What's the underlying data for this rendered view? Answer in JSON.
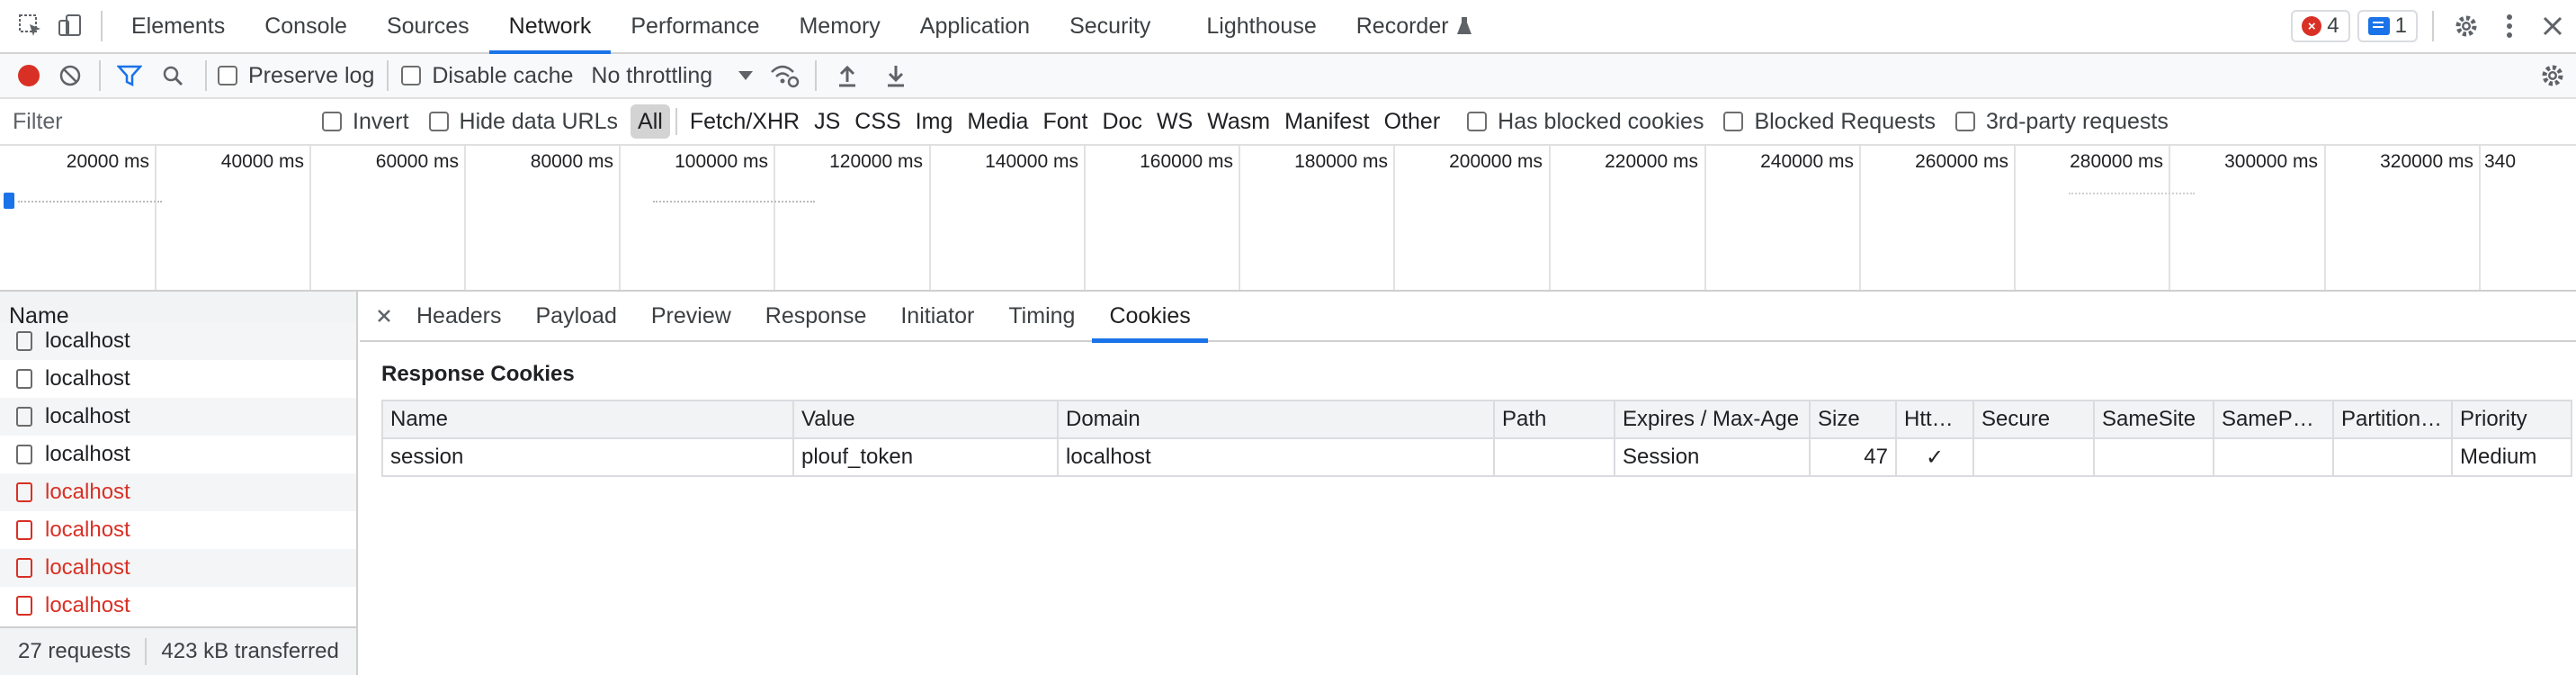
{
  "topbar": {
    "tabs": [
      "Elements",
      "Console",
      "Sources",
      "Network",
      "Performance",
      "Memory",
      "Application",
      "Security",
      "Lighthouse",
      "Recorder"
    ],
    "active_tab": "Network",
    "errors_count": "4",
    "messages_count": "1"
  },
  "toolbar": {
    "preserve_log": "Preserve log",
    "disable_cache": "Disable cache",
    "throttling": "No throttling"
  },
  "filterbar": {
    "placeholder": "Filter",
    "invert": "Invert",
    "hide_data_urls": "Hide data URLs",
    "types": [
      "All",
      "Fetch/XHR",
      "JS",
      "CSS",
      "Img",
      "Media",
      "Font",
      "Doc",
      "WS",
      "Wasm",
      "Manifest",
      "Other"
    ],
    "active_type": "All",
    "has_blocked_cookies": "Has blocked cookies",
    "blocked_requests": "Blocked Requests",
    "third_party": "3rd-party requests"
  },
  "overview": {
    "ticks": [
      "20000 ms",
      "40000 ms",
      "60000 ms",
      "80000 ms",
      "100000 ms",
      "120000 ms",
      "140000 ms",
      "160000 ms",
      "180000 ms",
      "200000 ms",
      "220000 ms",
      "240000 ms",
      "260000 ms",
      "280000 ms",
      "300000 ms",
      "320000 ms",
      "340"
    ]
  },
  "requests": {
    "header": "Name",
    "items": [
      {
        "name": "localhost",
        "error": false
      },
      {
        "name": "localhost",
        "error": false
      },
      {
        "name": "localhost",
        "error": false
      },
      {
        "name": "localhost",
        "error": false
      },
      {
        "name": "localhost",
        "error": true
      },
      {
        "name": "localhost",
        "error": true
      },
      {
        "name": "localhost",
        "error": true
      },
      {
        "name": "localhost",
        "error": true
      }
    ],
    "status_requests": "27 requests",
    "status_transferred": "423 kB transferred"
  },
  "details": {
    "tabs": [
      "Headers",
      "Payload",
      "Preview",
      "Response",
      "Initiator",
      "Timing",
      "Cookies"
    ],
    "active_tab": "Cookies",
    "section_title": "Response Cookies",
    "columns": [
      "Name",
      "Value",
      "Domain",
      "Path",
      "Expires / Max-Age",
      "Size",
      "HttpOnly",
      "Secure",
      "SameSite",
      "SameParty",
      "Partition Key",
      "Priority"
    ],
    "rows": [
      [
        "session",
        "plouf_token",
        "localhost",
        "",
        "Session",
        "47",
        "✓",
        "",
        "",
        "",
        "",
        "Medium"
      ]
    ]
  },
  "colors": {
    "accent": "#1a73e8",
    "record_red": "#d93025",
    "error_text": "#d93025"
  }
}
